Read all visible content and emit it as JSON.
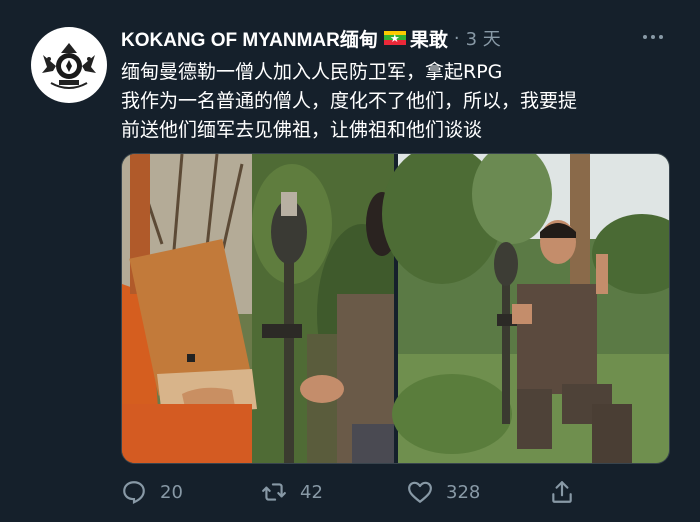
{
  "author": {
    "display_name": "KOKANG OF MYANMAR缅甸",
    "display_name_suffix": "果敢",
    "separator": "·",
    "timestamp": "3 天",
    "flag_icon": "myanmar-flag-icon",
    "avatar_icon": "crest-emblem-icon"
  },
  "tweet": {
    "lines": [
      "缅甸曼德勒一僧人加入人民防卫军，拿起RPG",
      "我作为一名普通的僧人，度化不了他们，所以，我要提",
      "前送他们缅军去见佛祖，让佛祖和他们谈谈"
    ]
  },
  "media": {
    "count": 2,
    "items": [
      {
        "description_icon": "photo-monk-with-rpg"
      },
      {
        "description_icon": "photo-man-with-rpg-in-forest"
      }
    ]
  },
  "actions": {
    "reply_count": "20",
    "retweet_count": "42",
    "like_count": "328"
  },
  "colors": {
    "background": "#15202b",
    "secondary_text": "#8899a6",
    "border": "#38444d"
  }
}
